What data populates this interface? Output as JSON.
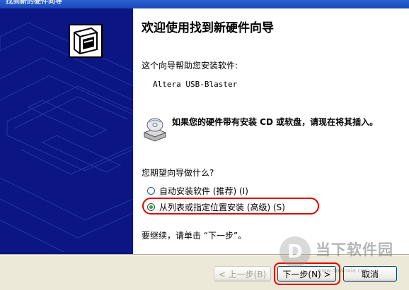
{
  "window": {
    "title": "找到新的硬件向导"
  },
  "wizard": {
    "heading": "欢迎使用找到新硬件向导",
    "intro": "这个向导帮助您安装软件:",
    "device_name": "Altera USB-Blaster",
    "cd_prompt": "如果您的硬件带有安装 CD 或软盘，请现在将其插入。",
    "question": "您期望向导做什么?",
    "options": [
      {
        "label": "自动安装软件 (推荐) (I)",
        "selected": false
      },
      {
        "label": "从列表或指定位置安装 (高级) (S)",
        "selected": true
      }
    ],
    "continue_text": "要继续，请单击 “下一步”。"
  },
  "buttons": {
    "back": "< 上一步(B)",
    "next": "下一步(N) >",
    "cancel": "取消"
  },
  "watermark": {
    "logo_char": "D",
    "text": "当下软件园",
    "url": "www.downxia.com"
  },
  "colors": {
    "sidebar": "#0b1583",
    "highlight": "#e00000",
    "radio_checked": "#3aa428"
  }
}
